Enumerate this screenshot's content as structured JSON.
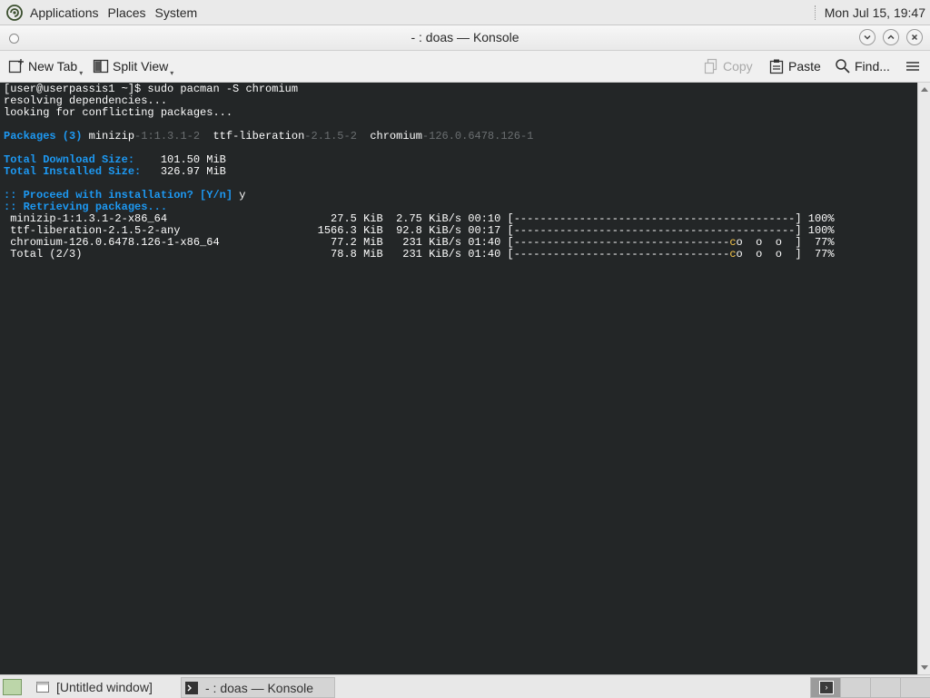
{
  "top_panel": {
    "menus": [
      "Applications",
      "Places",
      "System"
    ],
    "clock": "Mon Jul 15, 19:47"
  },
  "window": {
    "title": "- : doas — Konsole"
  },
  "toolbar": {
    "new_tab": "New Tab",
    "split_view": "Split View",
    "copy": "Copy",
    "paste": "Paste",
    "find": "Find..."
  },
  "terminal": {
    "lines": [
      [
        {
          "t": "[user@userpassis1 ~]$ sudo pacman -S chromium",
          "c": "wht"
        }
      ],
      [
        {
          "t": "resolving dependencies...",
          "c": "wht"
        }
      ],
      [
        {
          "t": "looking for conflicting packages...",
          "c": "wht"
        }
      ],
      [
        {
          "t": "",
          "c": "wht"
        }
      ],
      [
        {
          "t": "Packages (3) ",
          "c": "blue"
        },
        {
          "t": "minizip",
          "c": "wht"
        },
        {
          "t": "-1:1.3.1-2  ",
          "c": "dim"
        },
        {
          "t": "ttf-liberation",
          "c": "wht"
        },
        {
          "t": "-2.1.5-2  ",
          "c": "dim"
        },
        {
          "t": "chromium",
          "c": "wht"
        },
        {
          "t": "-126.0.6478.126-1",
          "c": "dim"
        }
      ],
      [
        {
          "t": "",
          "c": "wht"
        }
      ],
      [
        {
          "t": "Total Download Size:  ",
          "c": "blue"
        },
        {
          "t": "  101.50 MiB",
          "c": "wht"
        }
      ],
      [
        {
          "t": "Total Installed Size: ",
          "c": "blue"
        },
        {
          "t": "  326.97 MiB",
          "c": "wht"
        }
      ],
      [
        {
          "t": "",
          "c": "wht"
        }
      ],
      [
        {
          "t": ":: Proceed with installation? [Y/n] ",
          "c": "blue"
        },
        {
          "t": "y",
          "c": "wht"
        }
      ],
      [
        {
          "t": ":: Retrieving packages...",
          "c": "blue"
        }
      ],
      [
        {
          "t": " minizip-1:1.3.1-2-x86_64                         27.5 KiB  2.75 KiB/s 00:10 [-------------------------------------------] 100%",
          "c": "wht"
        }
      ],
      [
        {
          "t": " ttf-liberation-2.1.5-2-any                     1566.3 KiB  92.8 KiB/s 00:17 [-------------------------------------------] 100%",
          "c": "wht"
        }
      ],
      [
        {
          "t": " chromium-126.0.6478.126-1-x86_64                 77.2 MiB   231 KiB/s 01:40 [---------------------------------",
          "c": "wht"
        },
        {
          "t": "c",
          "c": "yel"
        },
        {
          "t": "o  o  o  ]  77%",
          "c": "wht"
        }
      ],
      [
        {
          "t": " Total (2/3)                                      78.8 MiB   231 KiB/s 01:40 [---------------------------------",
          "c": "wht"
        },
        {
          "t": "c",
          "c": "yel"
        },
        {
          "t": "o  o  o  ]  77%",
          "c": "wht"
        }
      ]
    ]
  },
  "taskbar": {
    "tasks": [
      "[Untitled window]",
      "- : doas — Konsole"
    ]
  },
  "colors": {
    "terminal_bg": "#232627",
    "terminal_fg": "#fcfcfc",
    "terminal_blue": "#1d99f3",
    "terminal_dim": "#6a6e70",
    "pacman_yellow": "#f7c84a"
  }
}
